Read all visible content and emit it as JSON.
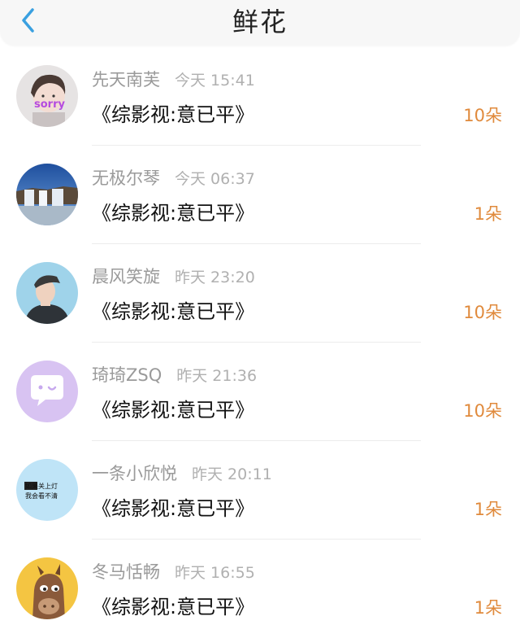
{
  "header": {
    "title": "鲜花",
    "back_icon": "chevron-left-icon",
    "accent": "#3aa0e0"
  },
  "colors": {
    "count": "#e08a3c",
    "name": "#9a9a9a",
    "time": "#b0b0b0"
  },
  "items": [
    {
      "name": "先天南芙",
      "time": "今天 15:41",
      "work": "《综影视:意已平》",
      "count": "10朵",
      "avatar": "girl-with-sorry-text-avatar",
      "avatar_text": "sorry"
    },
    {
      "name": "无极尔琴",
      "time": "今天 06:37",
      "work": "《综影视:意已平》",
      "count": "1朵",
      "avatar": "waterfall-avatar"
    },
    {
      "name": "晨风笑旋",
      "time": "昨天 23:20",
      "work": "《综影视:意已平》",
      "count": "10朵",
      "avatar": "boy-in-cap-avatar"
    },
    {
      "name": "琦琦ZSQ",
      "time": "昨天 21:36",
      "work": "《综影视:意已平》",
      "count": "10朵",
      "avatar": "purple-chat-bubble-avatar"
    },
    {
      "name": "一条小欣悦",
      "time": "昨天 20:11",
      "work": "《综影视:意已平》",
      "count": "1朵",
      "avatar": "text-meme-avatar",
      "avatar_text_line1": "如果关上灯",
      "avatar_text_line2": "我会看不清"
    },
    {
      "name": "冬马恬畅",
      "time": "昨天 16:55",
      "work": "《综影视:意已平》",
      "count": "1朵",
      "avatar": "cartoon-horse-avatar"
    }
  ]
}
